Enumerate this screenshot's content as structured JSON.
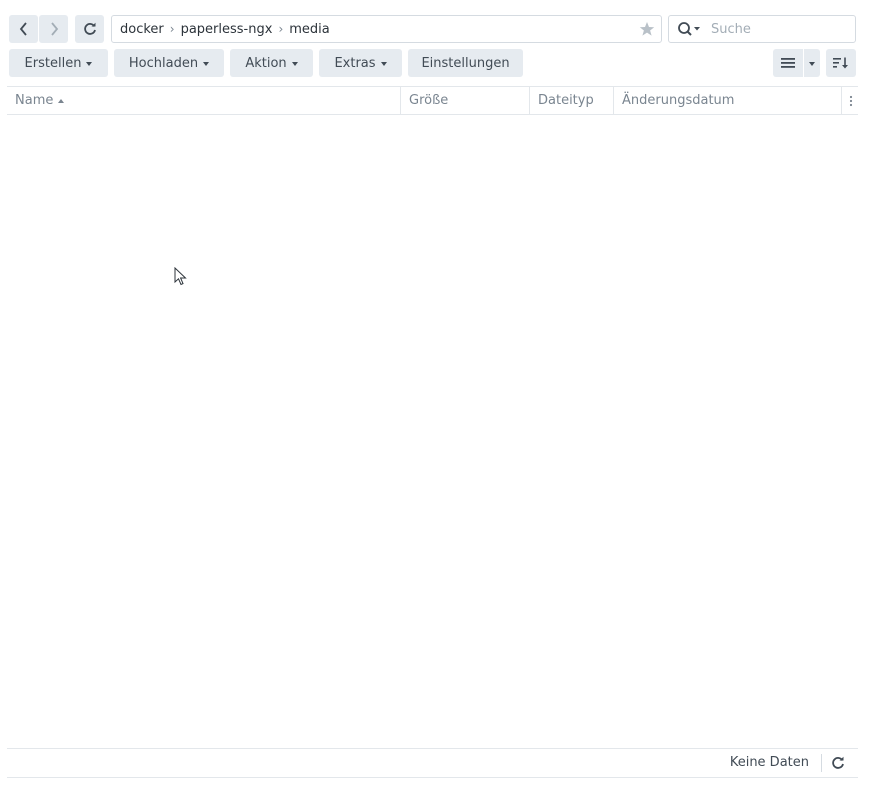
{
  "nav": {
    "back_icon": "chevron-left-icon",
    "forward_icon": "chevron-right-icon",
    "refresh_icon": "refresh-icon"
  },
  "breadcrumb": [
    "docker",
    "paperless-ngx",
    "media"
  ],
  "search": {
    "placeholder": "Suche"
  },
  "toolbar": {
    "create_label": "Erstellen",
    "upload_label": "Hochladen",
    "action_label": "Aktion",
    "extras_label": "Extras",
    "settings_label": "Einstellungen"
  },
  "table": {
    "columns": [
      "Name",
      "Größe",
      "Dateityp",
      "Änderungsdatum"
    ],
    "sorted_by": "Name",
    "rows": []
  },
  "footer": {
    "status_text": "Keine Daten"
  },
  "colors": {
    "button_bg": "#e6ebf0",
    "border": "#d5dbe1",
    "text": "#414b55",
    "muted": "#7a8590"
  }
}
